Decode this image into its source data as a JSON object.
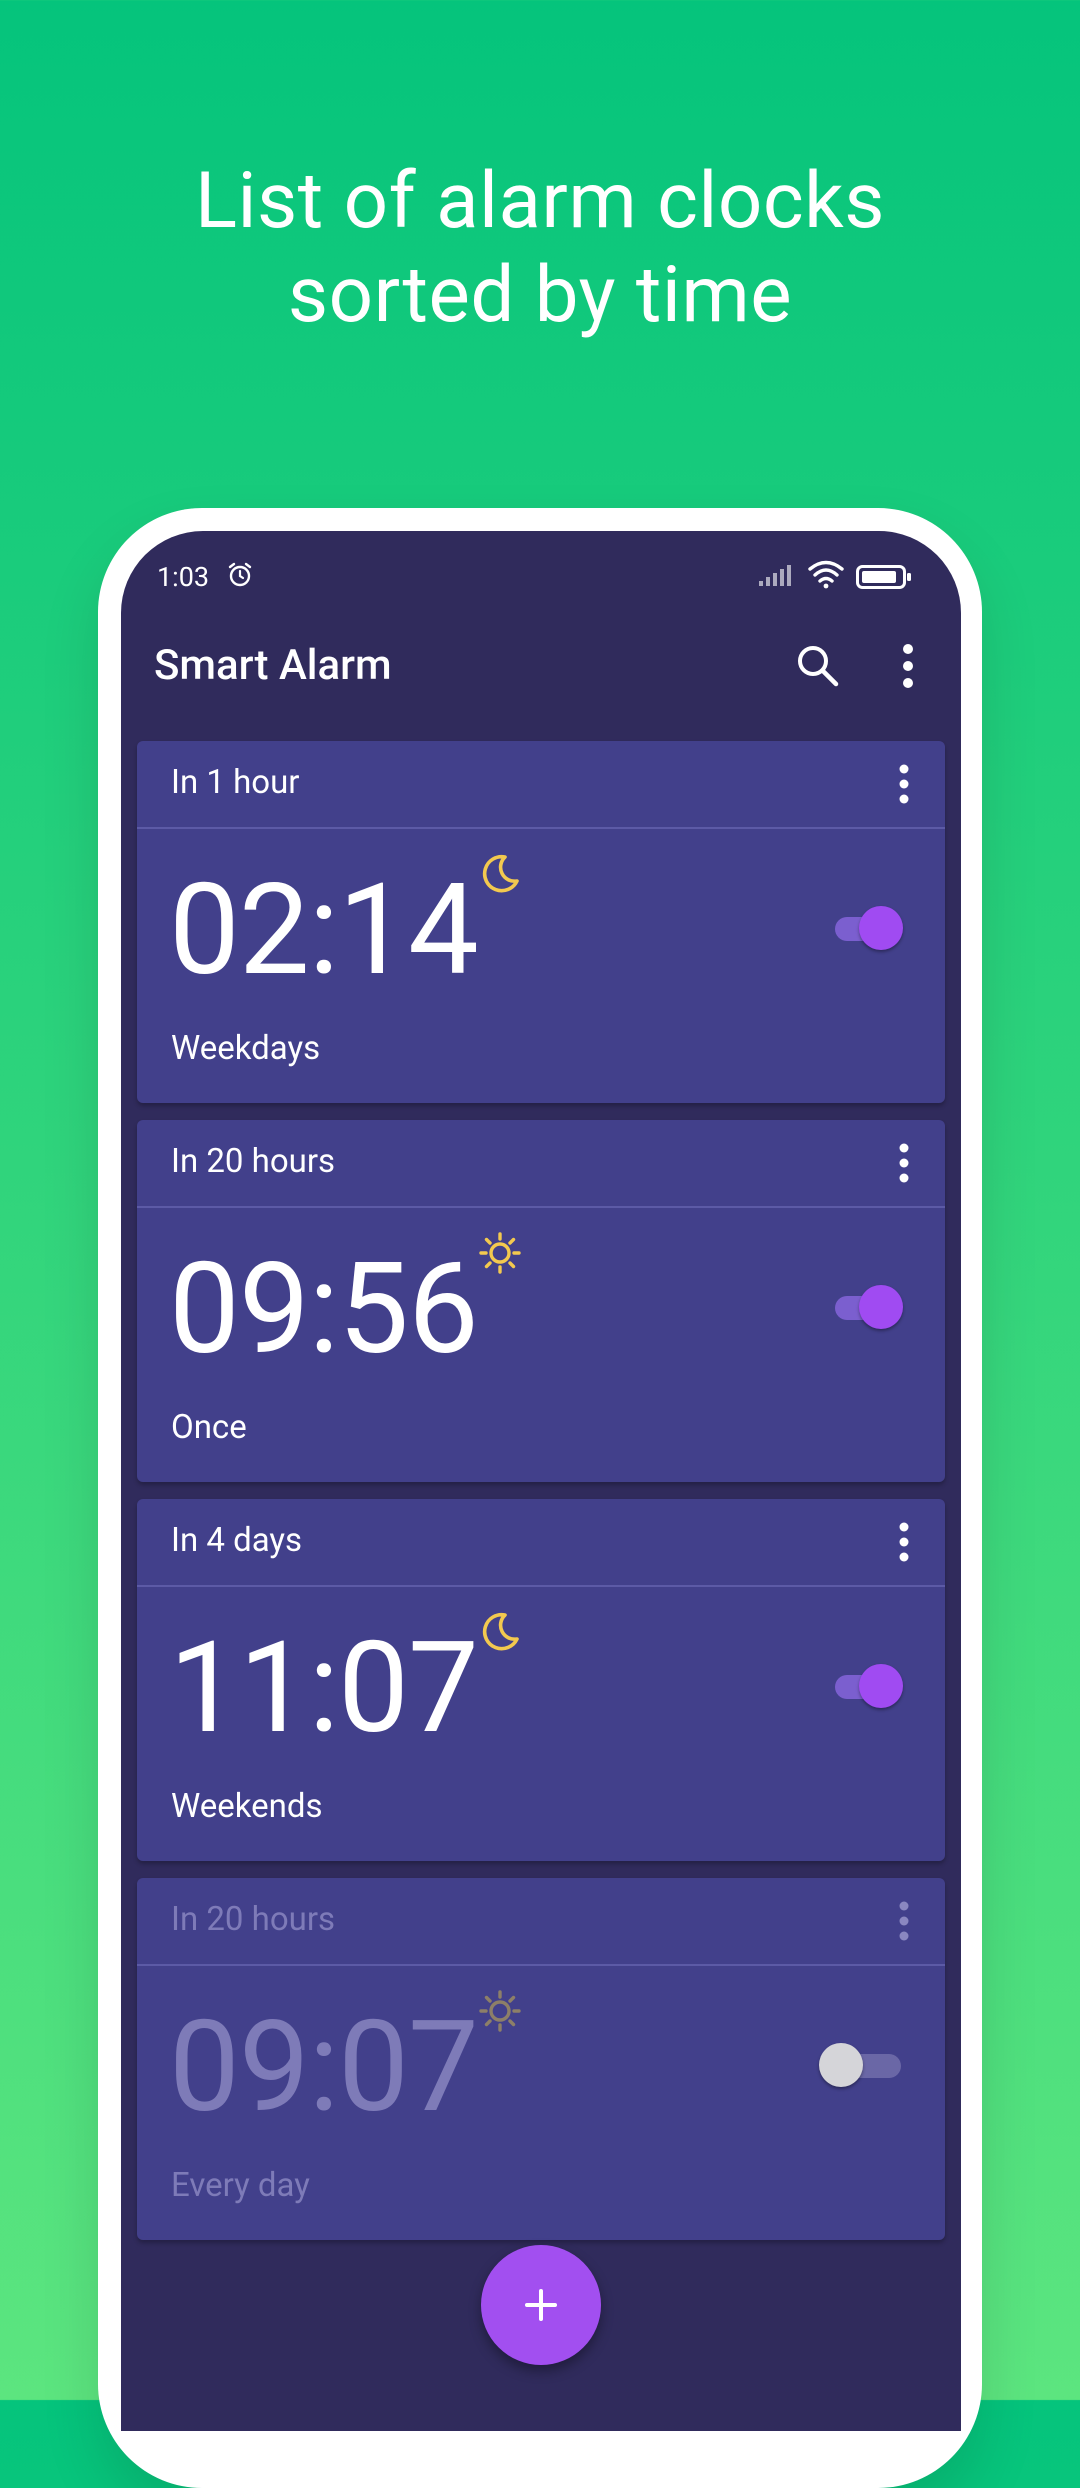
{
  "headline": {
    "line1": "List of alarm clocks",
    "line2": "sorted by time"
  },
  "status_bar": {
    "time": "1:03",
    "icons": [
      "alarm-icon",
      "signal-icon",
      "wifi-icon",
      "battery-icon"
    ]
  },
  "app_bar": {
    "title": "Smart Alarm",
    "actions": [
      "search-icon",
      "more-vert-icon"
    ]
  },
  "alarms": [
    {
      "when": "In 1 hour",
      "time": "02:14",
      "repeat": "Weekdays",
      "period_icon": "moon-icon",
      "enabled": true
    },
    {
      "when": "In 20 hours",
      "time": "09:56",
      "repeat": "Once",
      "period_icon": "sun-icon",
      "enabled": true
    },
    {
      "when": "In 4 days",
      "time": "11:07",
      "repeat": "Weekends",
      "period_icon": "moon-icon",
      "enabled": true
    },
    {
      "when": "In 20 hours",
      "time": "09:07",
      "repeat": "Every day",
      "period_icon": "sun-icon",
      "enabled": false
    }
  ],
  "fab": {
    "icon": "plus-icon"
  },
  "colors": {
    "background_top": "#05c47c",
    "background_bottom": "#5ce57f",
    "screen": "#302b5c",
    "card": "#42408b",
    "accent": "#a04bf2",
    "period_icon": "#f3c94f"
  }
}
